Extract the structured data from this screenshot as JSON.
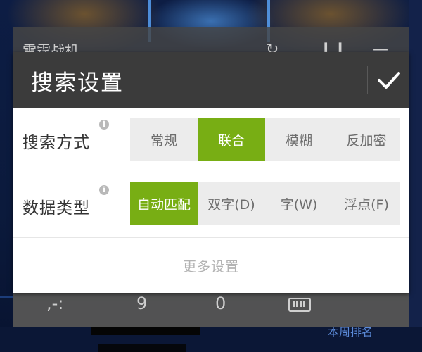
{
  "app": {
    "title": "雷霆战机",
    "icons": [
      "refresh-icon",
      "pause-icon",
      "minimize-icon"
    ]
  },
  "keypad": {
    "keys": [
      ",-:",
      "9",
      "0"
    ],
    "keyboard_icon": "keyboard-icon"
  },
  "background": {
    "weekly_rank_label": "本周排名"
  },
  "dialog": {
    "title": "搜索设置",
    "confirm_icon": "checkmark-icon",
    "search_mode": {
      "label": "搜索方式",
      "info_glyph": "i",
      "options": [
        "常规",
        "联合",
        "模糊",
        "反加密"
      ],
      "selected": "联合"
    },
    "data_type": {
      "label": "数据类型",
      "info_glyph": "i",
      "options": [
        "自动匹配",
        "双字(D)",
        "字(W)",
        "浮点(F)"
      ],
      "selected": "自动匹配"
    },
    "more_settings": "更多设置"
  },
  "colors": {
    "accent": "#78ae14",
    "header_bg": "#3b3b3b",
    "segment_bg": "#ececec"
  }
}
